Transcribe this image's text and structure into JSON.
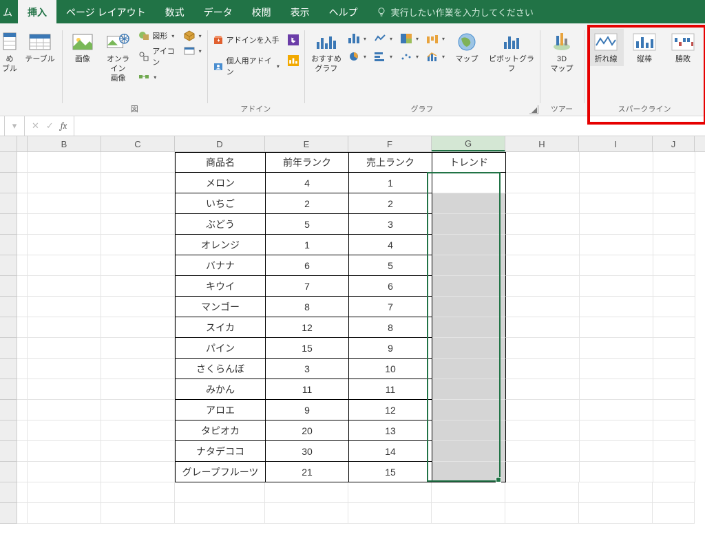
{
  "tabs": {
    "partial": "ム",
    "active": "挿入",
    "others": [
      "ページ レイアウト",
      "数式",
      "データ",
      "校閲",
      "表示",
      "ヘルプ"
    ],
    "tellme": "実行したい作業を入力してください"
  },
  "ribbon": {
    "tables": {
      "pt_partial": "め\nブル",
      "table": "テーブル",
      "group": ""
    },
    "illus": {
      "pic": "画像",
      "online": "オンライン\n画像",
      "shapes": "図形",
      "icons": "アイコン",
      "group": "図"
    },
    "addins": {
      "get": "アドインを入手",
      "my": "個人用アドイン",
      "group": "アドイン"
    },
    "charts": {
      "rec": "おすすめ\nグラフ",
      "map": "マップ",
      "pivot": "ピボットグラフ",
      "group": "グラフ"
    },
    "tours": {
      "map3d": "3D\nマップ",
      "group": "ツアー"
    },
    "spark": {
      "line": "折れ線",
      "col": "縦棒",
      "wl": "勝敗",
      "group": "スパークライン"
    }
  },
  "columns": [
    "B",
    "C",
    "D",
    "E",
    "F",
    "G",
    "H",
    "I",
    "J"
  ],
  "table_header": {
    "D": "商品名",
    "E": "前年ランク",
    "F": "売上ランク",
    "G": "トレンド"
  },
  "rows": [
    {
      "D": "メロン",
      "E": "4",
      "F": "1"
    },
    {
      "D": "いちご",
      "E": "2",
      "F": "2"
    },
    {
      "D": "ぶどう",
      "E": "5",
      "F": "3"
    },
    {
      "D": "オレンジ",
      "E": "1",
      "F": "4"
    },
    {
      "D": "バナナ",
      "E": "6",
      "F": "5"
    },
    {
      "D": "キウイ",
      "E": "7",
      "F": "6"
    },
    {
      "D": "マンゴー",
      "E": "8",
      "F": "7"
    },
    {
      "D": "スイカ",
      "E": "12",
      "F": "8"
    },
    {
      "D": "パイン",
      "E": "15",
      "F": "9"
    },
    {
      "D": "さくらんぼ",
      "E": "3",
      "F": "10"
    },
    {
      "D": "みかん",
      "E": "11",
      "F": "11"
    },
    {
      "D": "アロエ",
      "E": "9",
      "F": "12"
    },
    {
      "D": "タピオカ",
      "E": "20",
      "F": "13"
    },
    {
      "D": "ナタデココ",
      "E": "30",
      "F": "14"
    },
    {
      "D": "グレープフルーツ",
      "E": "21",
      "F": "15"
    }
  ]
}
